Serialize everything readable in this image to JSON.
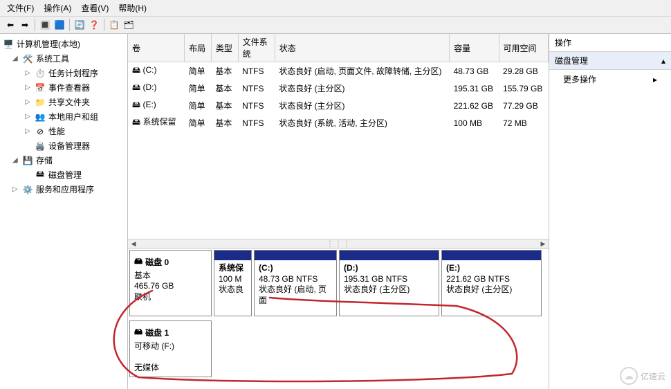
{
  "menu": {
    "file": "文件(F)",
    "action": "操作(A)",
    "view": "查看(V)",
    "help": "帮助(H)"
  },
  "tree": {
    "root": "计算机管理(本地)",
    "sys_tools": "系统工具",
    "task_sched": "任务计划程序",
    "event_viewer": "事件查看器",
    "shared": "共享文件夹",
    "local_users": "本地用户和组",
    "perf": "性能",
    "devmgr": "设备管理器",
    "storage": "存储",
    "diskmgmt": "磁盘管理",
    "services": "服务和应用程序"
  },
  "cols": {
    "vol": "卷",
    "layout": "布局",
    "type": "类型",
    "fs": "文件系统",
    "status": "状态",
    "cap": "容量",
    "free": "可用空间"
  },
  "vols": [
    {
      "name": "(C:)",
      "layout": "简单",
      "type": "基本",
      "fs": "NTFS",
      "status": "状态良好 (启动, 页面文件, 故障转储, 主分区)",
      "cap": "48.73 GB",
      "free": "29.28 GB"
    },
    {
      "name": "(D:)",
      "layout": "简单",
      "type": "基本",
      "fs": "NTFS",
      "status": "状态良好 (主分区)",
      "cap": "195.31 GB",
      "free": "155.79 GB"
    },
    {
      "name": "(E:)",
      "layout": "简单",
      "type": "基本",
      "fs": "NTFS",
      "status": "状态良好 (主分区)",
      "cap": "221.62 GB",
      "free": "77.29 GB"
    },
    {
      "name": "系统保留",
      "layout": "简单",
      "type": "基本",
      "fs": "NTFS",
      "status": "状态良好 (系统, 活动, 主分区)",
      "cap": "100 MB",
      "free": "72 MB"
    }
  ],
  "disk0": {
    "title": "磁盘 0",
    "type": "基本",
    "size": "465.76 GB",
    "state": "联机",
    "parts": [
      {
        "name": "系统保",
        "size": "100 M",
        "status": "状态良"
      },
      {
        "name": "(C:)",
        "size": "48.73 GB NTFS",
        "status": "状态良好 (启动, 页面"
      },
      {
        "name": "(D:)",
        "size": "195.31 GB NTFS",
        "status": "状态良好 (主分区)"
      },
      {
        "name": "(E:)",
        "size": "221.62 GB NTFS",
        "status": "状态良好 (主分区)"
      }
    ]
  },
  "disk1": {
    "title": "磁盘 1",
    "type": "可移动 (F:)",
    "state": "无媒体"
  },
  "actions": {
    "head": "操作",
    "sub": "磁盘管理",
    "more": "更多操作"
  },
  "watermark": "亿速云"
}
